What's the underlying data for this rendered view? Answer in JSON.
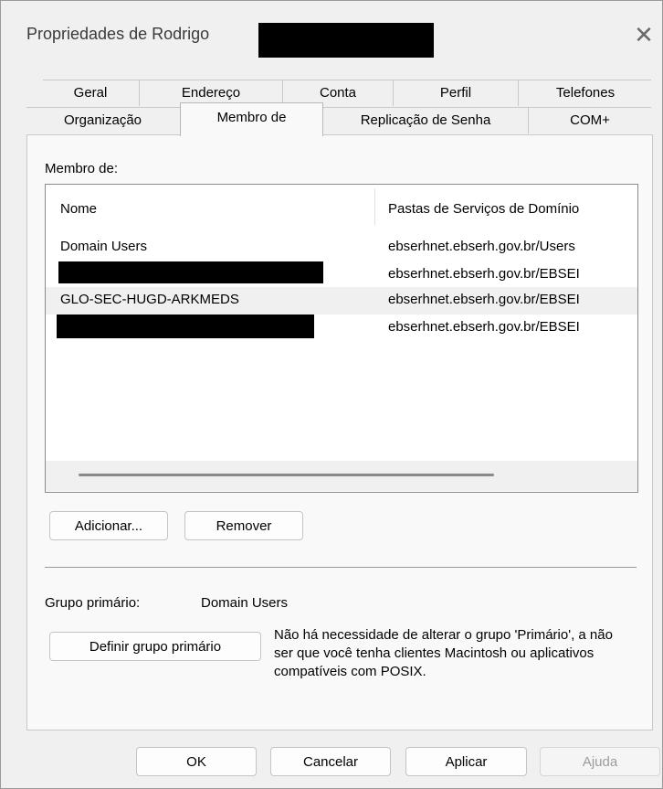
{
  "window": {
    "title": "Propriedades de Rodrigo",
    "close_glyph": "✕"
  },
  "tabs": {
    "row_back": [
      "Geral",
      "Endereço",
      "Conta",
      "Perfil",
      "Telefones"
    ],
    "row_front": [
      "Organização",
      "Membro de",
      "Replicação de Senha",
      "COM+"
    ],
    "active": "Membro de"
  },
  "member_of": {
    "label": "Membro de:",
    "columns": [
      "Nome",
      "Pastas de Serviços de Domínio"
    ],
    "rows": [
      {
        "name": "Domain Users",
        "folder": "ebserhnet.ebserh.gov.br/Users",
        "redacted": false,
        "selected": false
      },
      {
        "name": "",
        "folder": "ebserhnet.ebserh.gov.br/EBSEI",
        "redacted": true,
        "selected": false
      },
      {
        "name": "GLO-SEC-HUGD-ARKMEDS",
        "folder": "ebserhnet.ebserh.gov.br/EBSEI",
        "redacted": false,
        "selected": true
      },
      {
        "name": "",
        "folder": "ebserhnet.ebserh.gov.br/EBSEI",
        "redacted": true,
        "selected": false
      }
    ]
  },
  "buttons": {
    "add": "Adicionar...",
    "remove": "Remover",
    "set_primary": "Definir grupo primário",
    "ok": "OK",
    "cancel": "Cancelar",
    "apply": "Aplicar",
    "help": "Ajuda"
  },
  "primary_group": {
    "label": "Grupo primário:",
    "value": "Domain Users",
    "note": "Não há necessidade de alterar o grupo 'Primário', a não ser que você tenha clientes Macintosh ou aplicativos compatíveis com POSIX."
  }
}
